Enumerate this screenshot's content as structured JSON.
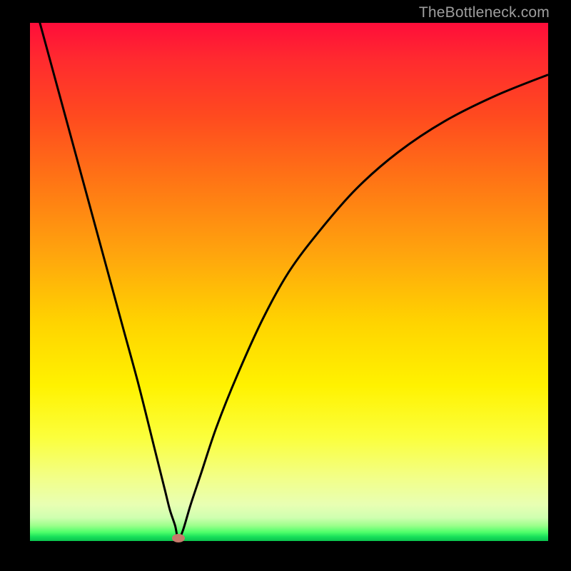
{
  "watermark": "TheBottleneck.com",
  "chart_data": {
    "type": "line",
    "title": "",
    "xlabel": "",
    "ylabel": "",
    "xlim": [
      0,
      100
    ],
    "ylim": [
      0,
      100
    ],
    "grid": false,
    "legend": false,
    "background_gradient": {
      "direction": "vertical",
      "stops": [
        {
          "pos": 0.0,
          "color": "#ff0d3a"
        },
        {
          "pos": 0.3,
          "color": "#ff6a16"
        },
        {
          "pos": 0.6,
          "color": "#ffe000"
        },
        {
          "pos": 0.9,
          "color": "#f0ff90"
        },
        {
          "pos": 0.97,
          "color": "#7dff7a"
        },
        {
          "pos": 1.0,
          "color": "#0ac24e"
        }
      ]
    },
    "series": [
      {
        "name": "bottleneck-curve",
        "color": "#000000",
        "x": [
          0,
          3,
          6,
          9,
          12,
          15,
          18,
          21,
          24,
          26,
          27,
          28,
          28.6,
          29.5,
          31,
          33,
          36,
          40,
          45,
          50,
          56,
          63,
          71,
          80,
          90,
          100
        ],
        "y": [
          107,
          96,
          85,
          74,
          63,
          52,
          41,
          30,
          18,
          10,
          6,
          3,
          0.5,
          2,
          7,
          13,
          22,
          32,
          43,
          52,
          60,
          68,
          75,
          81,
          86,
          90
        ]
      }
    ],
    "markers": [
      {
        "name": "minimum-point",
        "x": 28.6,
        "y": 0.6,
        "color": "#c77a6b",
        "shape": "ellipse"
      }
    ]
  }
}
